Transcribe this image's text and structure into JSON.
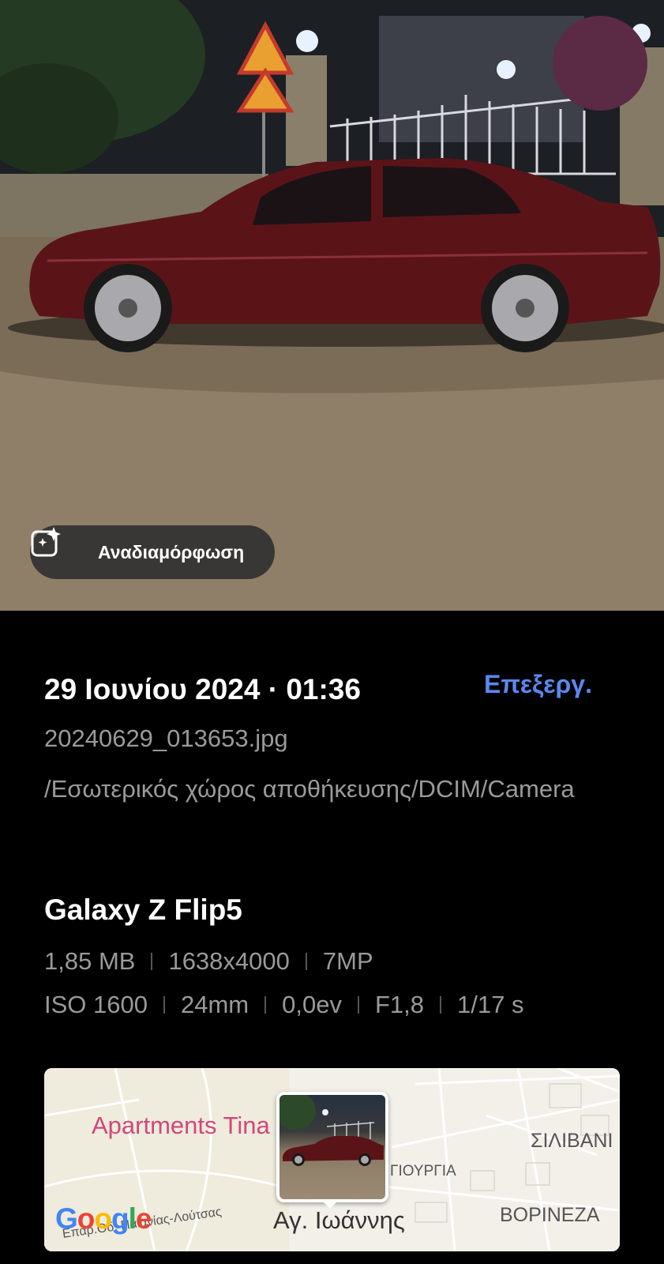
{
  "photo": {
    "remaster_button_label": "Αναδιαμόρφωση",
    "remaster_icon": "sparkle-image-icon"
  },
  "details": {
    "datetime": "29 Ιουνίου 2024 · 01:36",
    "edit_label": "Επεξεργ.",
    "filename": "20240629_013653.jpg",
    "path": "/Εσωτερικός χώρος αποθήκευσης/DCIM/Camera",
    "device": "Galaxy Z Flip5",
    "specs_row1": [
      "1,85 MB",
      "1638x4000",
      "7MP"
    ],
    "specs_row2": [
      "ISO 1600",
      "24mm",
      "0,0ev",
      "F1,8",
      "1/17 s"
    ]
  },
  "map": {
    "labels": {
      "apartments": "Apartments Tina",
      "silivani": "ΣΙΛΙΒΑΝΙ",
      "giourgia": "ΓΙΟΥΡΓΙΑ",
      "voryneza": "ΒΟΡΙΝΕΖΑ",
      "ioannis": "Αγ. Ιωάννης",
      "road": "Επαρ.Οδ. Παιανίας-Λούτσας"
    },
    "google_letters": [
      "G",
      "o",
      "o",
      "g",
      "l",
      "e"
    ],
    "google_colors": [
      "#4285f4",
      "#ea4335",
      "#fbbc05",
      "#4285f4",
      "#34a853",
      "#ea4335"
    ]
  },
  "colors": {
    "accent": "#5b87f0",
    "secondary_text": "#9a9a9a",
    "car_body": "#5a1418"
  }
}
